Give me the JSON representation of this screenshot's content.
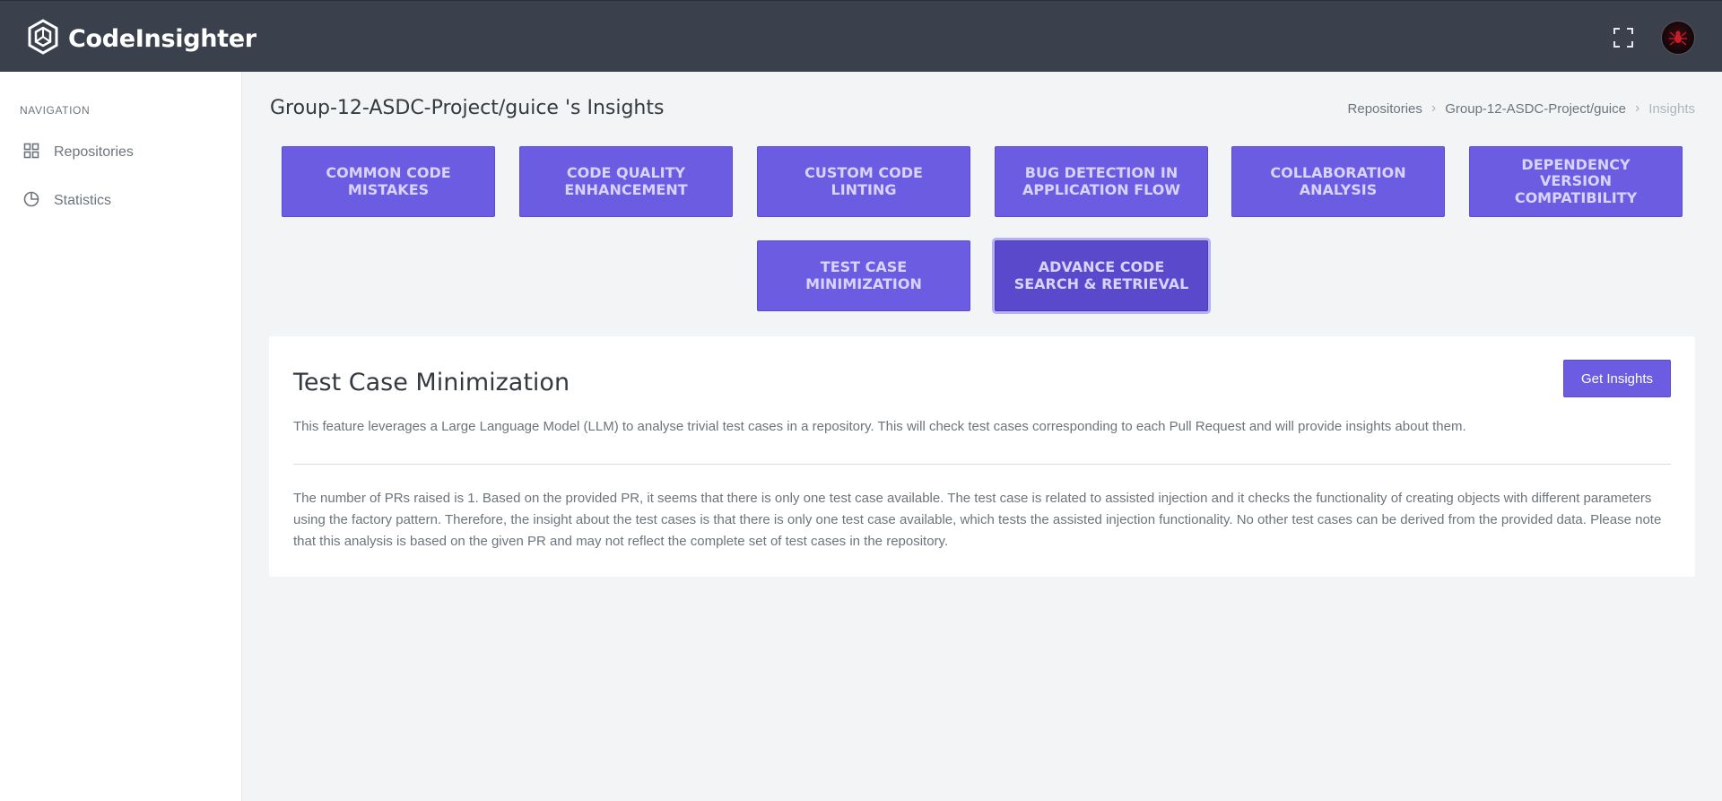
{
  "app": {
    "name": "CodeInsighter"
  },
  "sidebar": {
    "heading": "NAVIGATION",
    "items": [
      {
        "label": "Repositories",
        "icon": "grid-icon"
      },
      {
        "label": "Statistics",
        "icon": "pie-chart-icon"
      }
    ]
  },
  "page": {
    "title": "Group-12-ASDC-Project/guice 's Insights"
  },
  "breadcrumb": [
    "Repositories",
    "Group-12-ASDC-Project/guice",
    "Insights"
  ],
  "features": [
    "COMMON CODE MISTAKES",
    "CODE QUALITY ENHANCEMENT",
    "CUSTOM CODE LINTING",
    "BUG DETECTION IN APPLICATION FLOW",
    "COLLABORATION ANALYSIS",
    "DEPENDENCY VERSION COMPATIBILITY",
    "TEST CASE MINIMIZATION",
    "ADVANCE CODE SEARCH & RETRIEVAL"
  ],
  "card": {
    "title": "Test Case Minimization",
    "button": "Get Insights",
    "description": "This feature leverages a Large Language Model (LLM) to analyse trivial test cases in a repository. This will check test cases corresponding to each Pull Request and will provide insights about them.",
    "result": "The number of PRs raised is 1. Based on the provided PR, it seems that there is only one test case available. The test case is related to assisted injection and it checks the functionality of creating objects with different parameters using the factory pattern. Therefore, the insight about the test cases is that there is only one test case available, which tests the assisted injection functionality. No other test cases can be derived from the provided data. Please note that this analysis is based on the given PR and may not reflect the complete set of test cases in the repository."
  },
  "colors": {
    "topbar": "#3b414c",
    "accent": "#6c5ce1",
    "accent_active": "#5a49cb",
    "background": "#f3f4f6"
  }
}
